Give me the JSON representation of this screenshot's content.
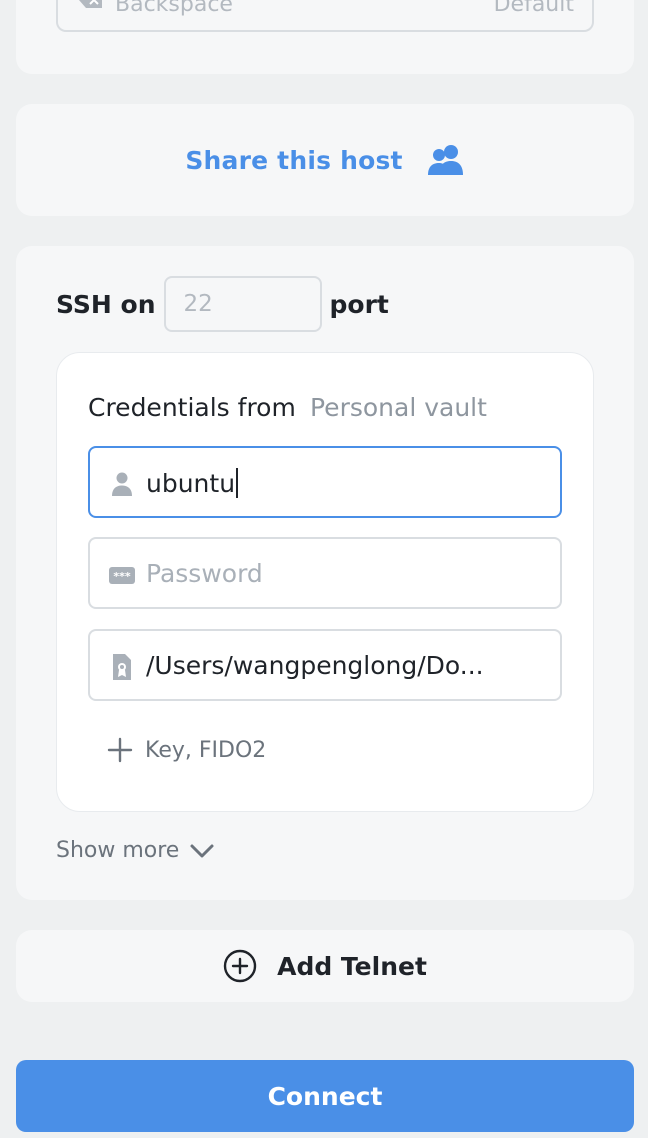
{
  "backspace": {
    "label": "Backspace",
    "value": "Default",
    "icon": "backspace-icon"
  },
  "share": {
    "label": "Share this host",
    "icon": "users-icon",
    "color": "#4a8fe7"
  },
  "ssh": {
    "prefix": "SSH on",
    "port_placeholder": "22",
    "suffix": "port"
  },
  "credentials": {
    "title": "Credentials from",
    "source": "Personal vault",
    "username": {
      "value": "ubuntu",
      "icon": "user-icon"
    },
    "password": {
      "placeholder": "Password",
      "icon": "password-icon"
    },
    "key": {
      "value": "/Users/wangpenglong/Do...",
      "icon": "key-file-icon"
    },
    "add_key": {
      "label": "Key, FIDO2",
      "icon": "plus-icon"
    }
  },
  "show_more": {
    "label": "Show more",
    "icon": "chevron-down-icon"
  },
  "telnet": {
    "label": "Add Telnet",
    "icon": "plus-circle-icon"
  },
  "connect": {
    "label": "Connect",
    "color": "#4a8fe7"
  }
}
